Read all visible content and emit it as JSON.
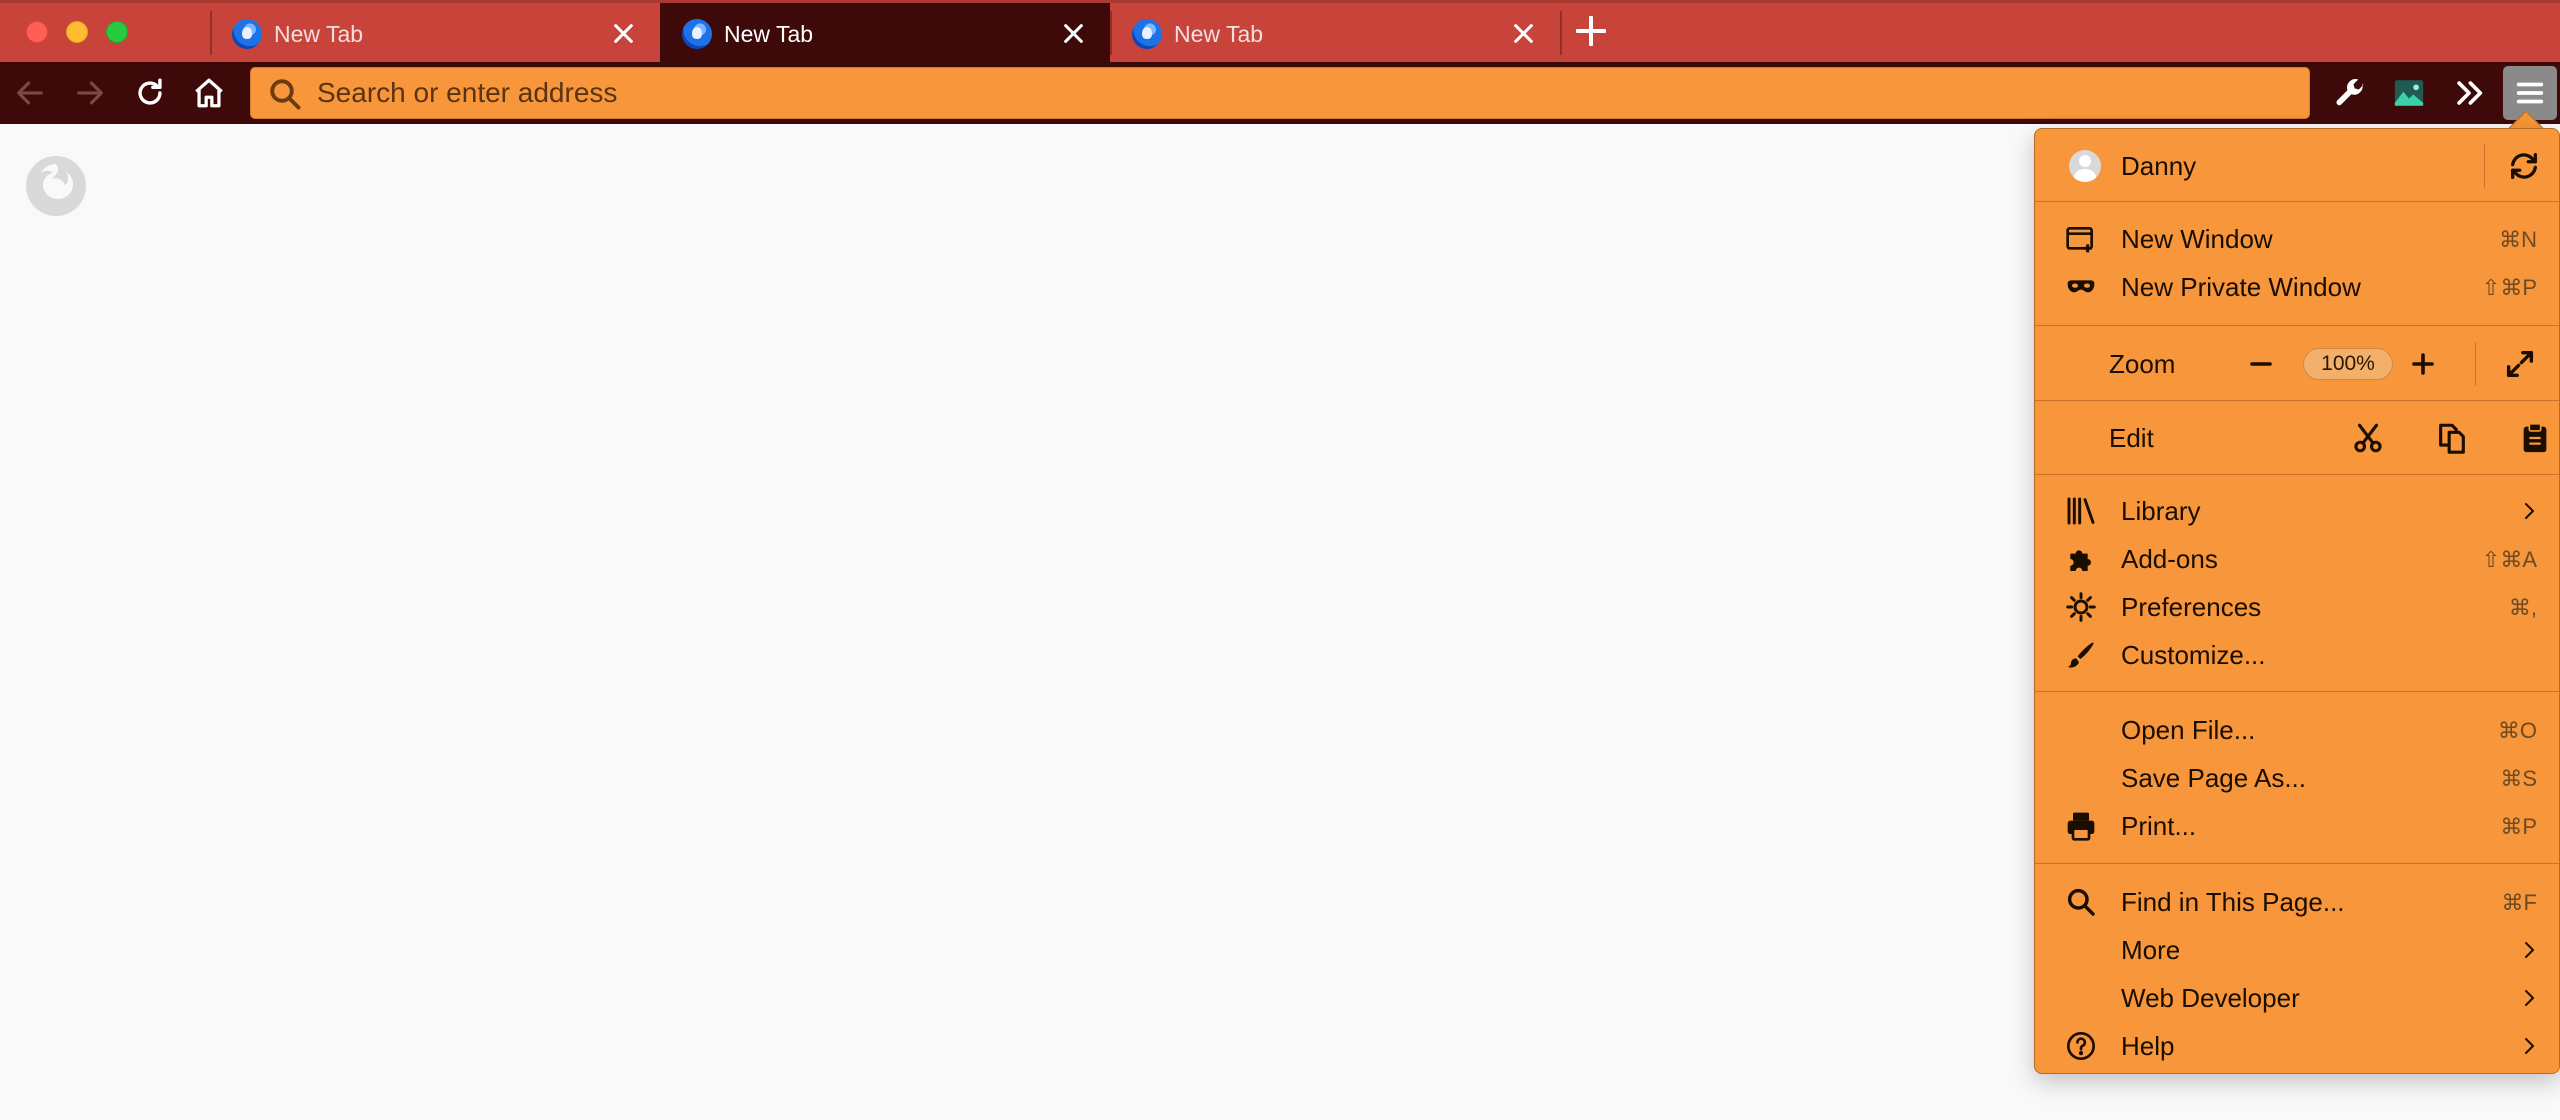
{
  "tabs": [
    {
      "title": "New Tab",
      "active": false
    },
    {
      "title": "New Tab",
      "active": true
    },
    {
      "title": "New Tab",
      "active": false
    }
  ],
  "urlbar": {
    "placeholder": "Search or enter address",
    "value": ""
  },
  "icons": {
    "back": "back-arrow-icon",
    "forward": "forward-arrow-icon",
    "reload": "reload-icon",
    "home": "home-icon",
    "devtools": "wrench-icon",
    "extension": "image-extension-icon",
    "overflow": "double-chevron-icon",
    "menu": "hamburger-menu-icon"
  },
  "colors": {
    "tabstrip": "#c8443a",
    "toolbar": "#3d0a09",
    "accent": "#f7963a"
  },
  "menu": {
    "user": {
      "name": "Danny"
    },
    "new_window": {
      "label": "New Window",
      "shortcut": "⌘N"
    },
    "new_private_window": {
      "label": "New Private Window",
      "shortcut": "⇧⌘P"
    },
    "zoom": {
      "label": "Zoom",
      "value": "100%",
      "minus": "−",
      "plus": "+"
    },
    "edit": {
      "label": "Edit"
    },
    "library": {
      "label": "Library"
    },
    "addons": {
      "label": "Add-ons",
      "shortcut": "⇧⌘A"
    },
    "preferences": {
      "label": "Preferences",
      "shortcut": "⌘,"
    },
    "customize": {
      "label": "Customize..."
    },
    "open_file": {
      "label": "Open File...",
      "shortcut": "⌘O"
    },
    "save_page": {
      "label": "Save Page As...",
      "shortcut": "⌘S"
    },
    "print": {
      "label": "Print...",
      "shortcut": "⌘P"
    },
    "find": {
      "label": "Find in This Page...",
      "shortcut": "⌘F"
    },
    "more": {
      "label": "More"
    },
    "web_developer": {
      "label": "Web Developer"
    },
    "help": {
      "label": "Help"
    }
  }
}
